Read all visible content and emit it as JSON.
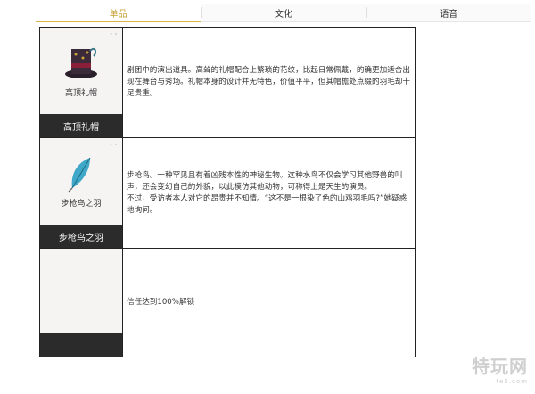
{
  "tabs": [
    {
      "label": "单品",
      "active": true
    },
    {
      "label": "文化",
      "active": false
    },
    {
      "label": "语音",
      "active": false
    }
  ],
  "items": [
    {
      "card_title": "高顶礼帽",
      "name": "高顶礼帽",
      "icon": "top-hat-icon",
      "description": "剧团中的演出道具。高耸的礼帽配合上繁琐的花纹，比起日常佩戴，的确更加适合出现在舞台与秀场。礼帽本身的设计并无特色，价值平平，但其帽檐处点缀的羽毛却十足贵重。"
    },
    {
      "card_title": "步枪鸟之羽",
      "name": "步枪鸟之羽",
      "icon": "feather-icon",
      "description": "步枪鸟。一种罕见且有着凶残本性的神秘生物。这种水鸟不仅会学习其他野兽的叫声，还会变幻自己的外貌，以此模仿其他动物，可称得上是天生的演员。\n不过，受访者本人对它的昂贵并不知情。“这不是一根染了色的山鸡羽毛吗?”她疑惑地询问。"
    },
    {
      "card_title": "",
      "name": "",
      "icon": "",
      "description": "信任达到100%解锁"
    }
  ],
  "watermark": {
    "text": "特玩网",
    "sub": "te5.com"
  },
  "colors": {
    "accent": "#d8b44a",
    "namebar": "#2b2b2b",
    "border": "#222222"
  }
}
